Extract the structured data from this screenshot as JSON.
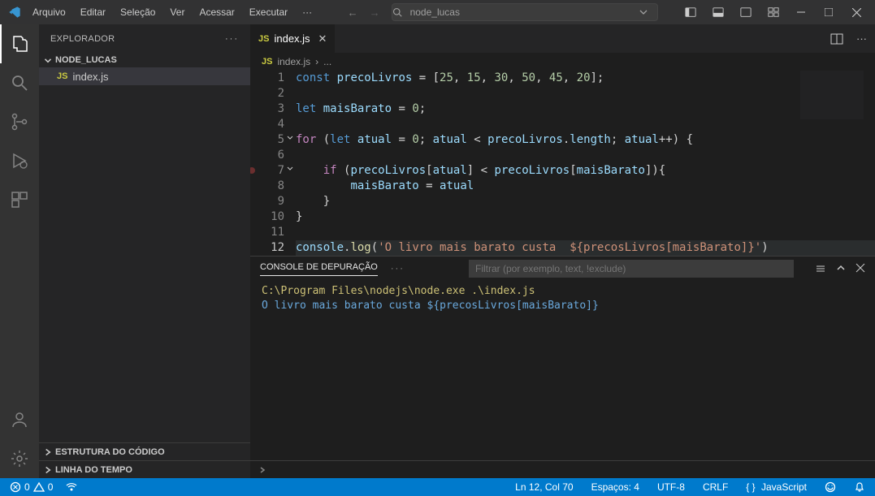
{
  "titlebar": {
    "menus": [
      "Arquivo",
      "Editar",
      "Seleção",
      "Ver",
      "Acessar",
      "Executar"
    ],
    "search_text": "node_lucas"
  },
  "sidebar": {
    "title": "EXPLORADOR",
    "project": "NODE_LUCAS",
    "file": "index.js",
    "outline": "ESTRUTURA DO CÓDIGO",
    "timeline": "LINHA DO TEMPO"
  },
  "tab": {
    "name": "index.js"
  },
  "breadcrumb": {
    "file": "index.js"
  },
  "code_lines": [
    "const precoLivros = [25, 15, 30, 50, 45, 20];",
    "",
    "let maisBarato = 0;",
    "",
    "for (let atual = 0; atual < precoLivros.length; atual++) {",
    "",
    "    if (precoLivros[atual] < precoLivros[maisBarato]){",
    "        maisBarato = atual",
    "    }",
    "}",
    "",
    "console.log('O livro mais barato custa  ${precosLivros[maisBarato]}')"
  ],
  "panel": {
    "title": "CONSOLE DE DEPURAÇÃO",
    "filter_placeholder": "Filtrar (por exemplo, text, !exclude)",
    "output_cmd": "C:\\Program Files\\nodejs\\node.exe .\\index.js",
    "output_log": "O livro mais barato custa  ${precosLivros[maisBarato]}"
  },
  "statusbar": {
    "errors": "0",
    "warnings": "0",
    "pos": "Ln 12, Col 70",
    "spaces": "Espaços: 4",
    "encoding": "UTF-8",
    "eol": "CRLF",
    "lang": "JavaScript"
  }
}
